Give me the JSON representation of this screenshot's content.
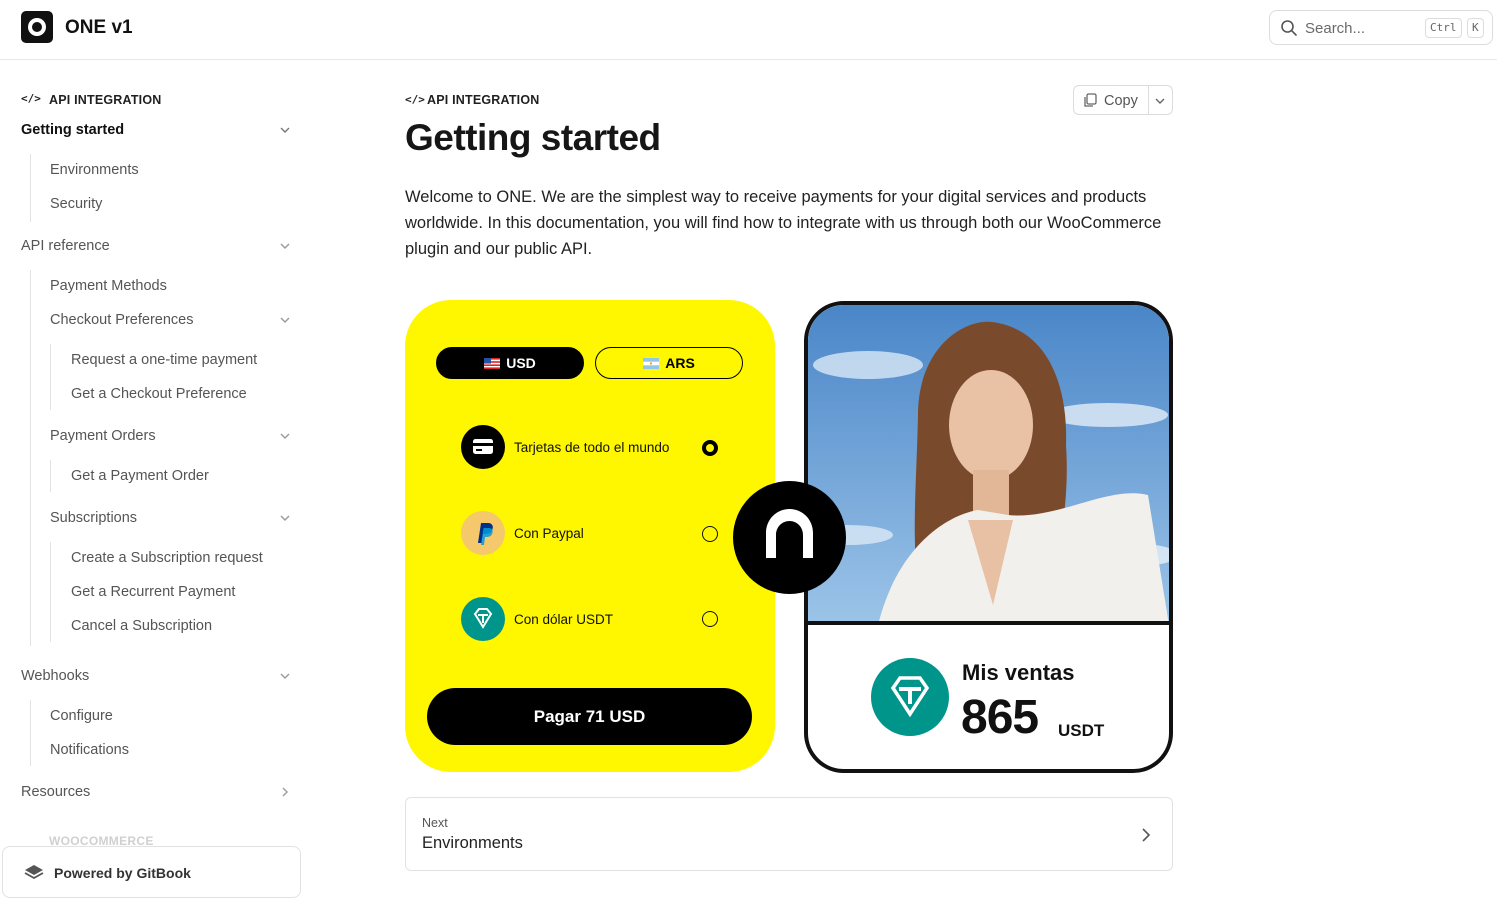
{
  "header": {
    "brand": "ONE v1",
    "search_placeholder": "Search...",
    "shortcut_keys": [
      "Ctrl",
      "K"
    ]
  },
  "sidebar": {
    "section_label": "API INTEGRATION",
    "items": [
      {
        "label": "Getting started",
        "active": true
      },
      {
        "label": "Environments"
      },
      {
        "label": "Security"
      },
      {
        "label": "API reference"
      },
      {
        "label": "Payment Methods"
      },
      {
        "label": "Checkout Preferences"
      },
      {
        "label": "Request a one-time payment"
      },
      {
        "label": "Get a Checkout Preference"
      },
      {
        "label": "Payment Orders"
      },
      {
        "label": "Get a Payment Order"
      },
      {
        "label": "Subscriptions"
      },
      {
        "label": "Create a Subscription request"
      },
      {
        "label": "Get a Recurrent Payment"
      },
      {
        "label": "Cancel a Subscription"
      },
      {
        "label": "Webhooks"
      },
      {
        "label": "Configure"
      },
      {
        "label": "Notifications"
      },
      {
        "label": "Resources"
      }
    ],
    "next_section_label": "WOOCOMMERCE",
    "powered_by": "Powered by GitBook"
  },
  "main": {
    "breadcrumb": "API INTEGRATION",
    "title": "Getting started",
    "copy_label": "Copy",
    "intro": "Welcome to ONE. We are the simplest way to receive payments for your digital services and products worldwide. In this documentation, you will find how to integrate with us through both our WooCommerce plugin and our public API.",
    "illustration": {
      "currencies": [
        "USD",
        "ARS"
      ],
      "options": [
        "Tarjetas de todo el mundo",
        "Con Paypal",
        "Con dólar USDT"
      ],
      "pay_button": "Pagar 71 USD",
      "sales_label": "Mis ventas",
      "sales_value": "865",
      "sales_unit": "USDT"
    },
    "next": {
      "label": "Next",
      "title": "Environments"
    }
  },
  "colors": {
    "accent_yellow": "#fff700",
    "usdt_teal": "#00958a",
    "paypal_bg": "#f5c86b"
  }
}
